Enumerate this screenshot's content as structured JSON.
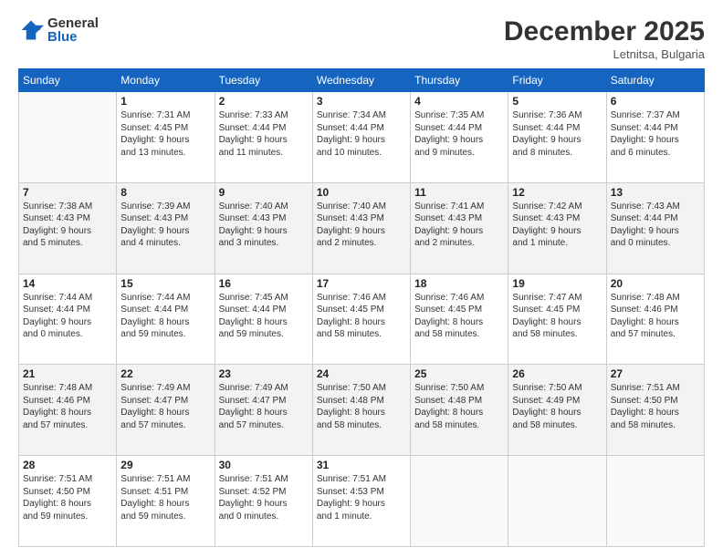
{
  "logo": {
    "general": "General",
    "blue": "Blue"
  },
  "title": "December 2025",
  "subtitle": "Letnitsa, Bulgaria",
  "days_of_week": [
    "Sunday",
    "Monday",
    "Tuesday",
    "Wednesday",
    "Thursday",
    "Friday",
    "Saturday"
  ],
  "weeks": [
    [
      {
        "num": "",
        "info": ""
      },
      {
        "num": "1",
        "info": "Sunrise: 7:31 AM\nSunset: 4:45 PM\nDaylight: 9 hours\nand 13 minutes."
      },
      {
        "num": "2",
        "info": "Sunrise: 7:33 AM\nSunset: 4:44 PM\nDaylight: 9 hours\nand 11 minutes."
      },
      {
        "num": "3",
        "info": "Sunrise: 7:34 AM\nSunset: 4:44 PM\nDaylight: 9 hours\nand 10 minutes."
      },
      {
        "num": "4",
        "info": "Sunrise: 7:35 AM\nSunset: 4:44 PM\nDaylight: 9 hours\nand 9 minutes."
      },
      {
        "num": "5",
        "info": "Sunrise: 7:36 AM\nSunset: 4:44 PM\nDaylight: 9 hours\nand 8 minutes."
      },
      {
        "num": "6",
        "info": "Sunrise: 7:37 AM\nSunset: 4:44 PM\nDaylight: 9 hours\nand 6 minutes."
      }
    ],
    [
      {
        "num": "7",
        "info": "Sunrise: 7:38 AM\nSunset: 4:43 PM\nDaylight: 9 hours\nand 5 minutes."
      },
      {
        "num": "8",
        "info": "Sunrise: 7:39 AM\nSunset: 4:43 PM\nDaylight: 9 hours\nand 4 minutes."
      },
      {
        "num": "9",
        "info": "Sunrise: 7:40 AM\nSunset: 4:43 PM\nDaylight: 9 hours\nand 3 minutes."
      },
      {
        "num": "10",
        "info": "Sunrise: 7:40 AM\nSunset: 4:43 PM\nDaylight: 9 hours\nand 2 minutes."
      },
      {
        "num": "11",
        "info": "Sunrise: 7:41 AM\nSunset: 4:43 PM\nDaylight: 9 hours\nand 2 minutes."
      },
      {
        "num": "12",
        "info": "Sunrise: 7:42 AM\nSunset: 4:43 PM\nDaylight: 9 hours\nand 1 minute."
      },
      {
        "num": "13",
        "info": "Sunrise: 7:43 AM\nSunset: 4:44 PM\nDaylight: 9 hours\nand 0 minutes."
      }
    ],
    [
      {
        "num": "14",
        "info": "Sunrise: 7:44 AM\nSunset: 4:44 PM\nDaylight: 9 hours\nand 0 minutes."
      },
      {
        "num": "15",
        "info": "Sunrise: 7:44 AM\nSunset: 4:44 PM\nDaylight: 8 hours\nand 59 minutes."
      },
      {
        "num": "16",
        "info": "Sunrise: 7:45 AM\nSunset: 4:44 PM\nDaylight: 8 hours\nand 59 minutes."
      },
      {
        "num": "17",
        "info": "Sunrise: 7:46 AM\nSunset: 4:45 PM\nDaylight: 8 hours\nand 58 minutes."
      },
      {
        "num": "18",
        "info": "Sunrise: 7:46 AM\nSunset: 4:45 PM\nDaylight: 8 hours\nand 58 minutes."
      },
      {
        "num": "19",
        "info": "Sunrise: 7:47 AM\nSunset: 4:45 PM\nDaylight: 8 hours\nand 58 minutes."
      },
      {
        "num": "20",
        "info": "Sunrise: 7:48 AM\nSunset: 4:46 PM\nDaylight: 8 hours\nand 57 minutes."
      }
    ],
    [
      {
        "num": "21",
        "info": "Sunrise: 7:48 AM\nSunset: 4:46 PM\nDaylight: 8 hours\nand 57 minutes."
      },
      {
        "num": "22",
        "info": "Sunrise: 7:49 AM\nSunset: 4:47 PM\nDaylight: 8 hours\nand 57 minutes."
      },
      {
        "num": "23",
        "info": "Sunrise: 7:49 AM\nSunset: 4:47 PM\nDaylight: 8 hours\nand 57 minutes."
      },
      {
        "num": "24",
        "info": "Sunrise: 7:50 AM\nSunset: 4:48 PM\nDaylight: 8 hours\nand 58 minutes."
      },
      {
        "num": "25",
        "info": "Sunrise: 7:50 AM\nSunset: 4:48 PM\nDaylight: 8 hours\nand 58 minutes."
      },
      {
        "num": "26",
        "info": "Sunrise: 7:50 AM\nSunset: 4:49 PM\nDaylight: 8 hours\nand 58 minutes."
      },
      {
        "num": "27",
        "info": "Sunrise: 7:51 AM\nSunset: 4:50 PM\nDaylight: 8 hours\nand 58 minutes."
      }
    ],
    [
      {
        "num": "28",
        "info": "Sunrise: 7:51 AM\nSunset: 4:50 PM\nDaylight: 8 hours\nand 59 minutes."
      },
      {
        "num": "29",
        "info": "Sunrise: 7:51 AM\nSunset: 4:51 PM\nDaylight: 8 hours\nand 59 minutes."
      },
      {
        "num": "30",
        "info": "Sunrise: 7:51 AM\nSunset: 4:52 PM\nDaylight: 9 hours\nand 0 minutes."
      },
      {
        "num": "31",
        "info": "Sunrise: 7:51 AM\nSunset: 4:53 PM\nDaylight: 9 hours\nand 1 minute."
      },
      {
        "num": "",
        "info": ""
      },
      {
        "num": "",
        "info": ""
      },
      {
        "num": "",
        "info": ""
      }
    ]
  ]
}
